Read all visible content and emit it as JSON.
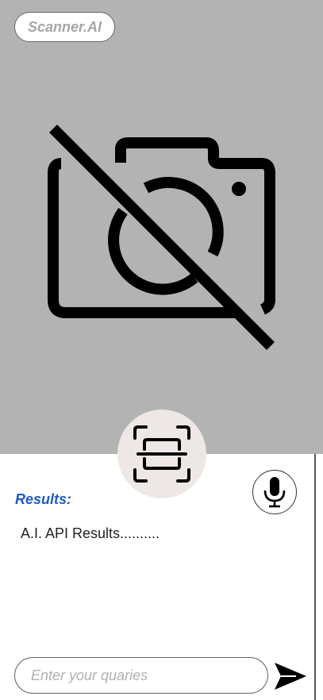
{
  "app": {
    "brand_label": "Scanner.AI"
  },
  "camera": {
    "state_icon": "camera-off-icon"
  },
  "scan": {
    "icon": "scan-frame-icon"
  },
  "voice": {
    "icon": "microphone-icon"
  },
  "results": {
    "label": "Results:",
    "text": "A.I. API Results.........."
  },
  "query": {
    "placeholder": "Enter your quaries",
    "value": ""
  },
  "send": {
    "icon": "send-arrow-icon"
  },
  "colors": {
    "camera_background": "#b3b3b3",
    "results_label": "#1f5cc4",
    "scan_button_background": "#ede8e6"
  }
}
